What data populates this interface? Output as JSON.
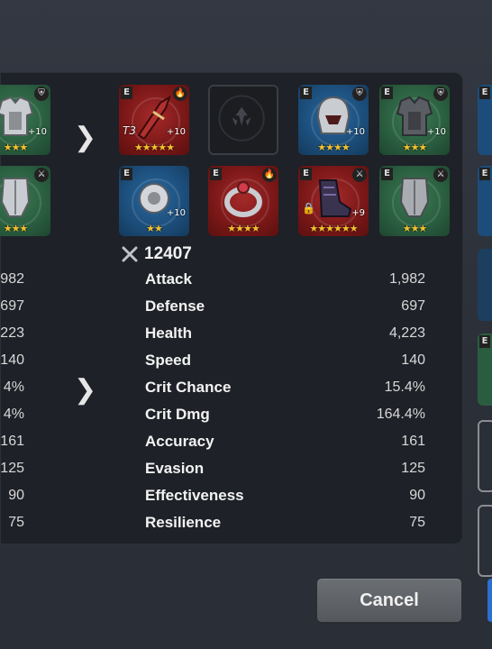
{
  "current_set": {
    "row1": [
      {
        "grade": "",
        "set_icon": "shield-icon",
        "plus": "+10",
        "stars": "★★★",
        "color": "green"
      }
    ],
    "row2": [
      {
        "grade": "",
        "set_icon": "sword-icon",
        "plus": "",
        "stars": "★★★",
        "color": "green"
      }
    ],
    "stats": [
      "982",
      "697",
      "223",
      "140",
      "4%",
      "4%",
      "161",
      "125",
      "90",
      "75"
    ]
  },
  "new_set": {
    "row1": [
      {
        "name": "weapon",
        "grade": "E",
        "set_icon": "fire-icon",
        "tier": "T3",
        "plus": "+10",
        "stars": "★★★★★",
        "color": "red"
      },
      {
        "name": "empty",
        "grade": "",
        "set_icon": "",
        "tier": "",
        "plus": "",
        "stars": "",
        "color": "empty"
      },
      {
        "name": "helmet",
        "grade": "E",
        "set_icon": "shield-icon",
        "tier": "",
        "plus": "+10",
        "stars": "★★★★",
        "color": "blue"
      },
      {
        "name": "armor",
        "grade": "E",
        "set_icon": "shield-icon",
        "tier": "",
        "plus": "+10",
        "stars": "★★★",
        "color": "green"
      }
    ],
    "row2": [
      {
        "name": "necklace",
        "grade": "E",
        "set_icon": "",
        "tier": "",
        "plus": "+10",
        "stars": "★★",
        "color": "blue"
      },
      {
        "name": "ring",
        "grade": "E",
        "set_icon": "fire-icon",
        "tier": "",
        "plus": "",
        "stars": "★★★★",
        "color": "red"
      },
      {
        "name": "boots",
        "grade": "E",
        "set_icon": "sword-icon",
        "tier": "",
        "plus": "+9",
        "stars": "★★★★★★",
        "color": "red"
      },
      {
        "name": "greaves",
        "grade": "E",
        "set_icon": "sword-icon",
        "tier": "",
        "plus": "",
        "stars": "★★★",
        "color": "green"
      }
    ],
    "power": "12407",
    "stats": [
      {
        "label": "Attack",
        "value": "1,982"
      },
      {
        "label": "Defense",
        "value": "697"
      },
      {
        "label": "Health",
        "value": "4,223"
      },
      {
        "label": "Speed",
        "value": "140"
      },
      {
        "label": "Crit Chance",
        "value": "15.4%"
      },
      {
        "label": "Crit Dmg",
        "value": "164.4%"
      },
      {
        "label": "Accuracy",
        "value": "161"
      },
      {
        "label": "Evasion",
        "value": "125"
      },
      {
        "label": "Effectiveness",
        "value": "90"
      },
      {
        "label": "Resilience",
        "value": "75"
      }
    ]
  },
  "right_partial": {
    "grades": [
      "E",
      "E",
      "E"
    ]
  },
  "buttons": {
    "cancel": "Cancel"
  },
  "colors": {
    "panel": "#1e2127",
    "accent_blue": "#2c6fcf",
    "star": "#f2c12e"
  }
}
